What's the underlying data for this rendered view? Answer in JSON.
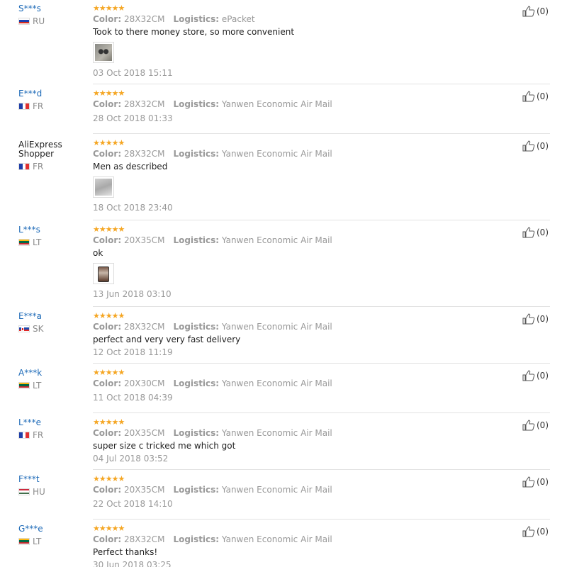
{
  "labels": {
    "color": "Color:",
    "logistics": "Logistics:"
  },
  "stars": "★★★★★",
  "reviews": [
    {
      "user": "S***s",
      "country": "RU",
      "flag": "ru",
      "color": "28X32CM",
      "logistics": "ePacket",
      "comment": "Took to there money store, so more convenient",
      "thumb": "earrings-photo",
      "date": "03 Oct 2018 15:11",
      "likes": "(0)"
    },
    {
      "user": "E***d",
      "country": "FR",
      "flag": "fr",
      "color": "28X32CM",
      "logistics": "Yanwen Economic Air Mail",
      "comment": "",
      "thumb": "",
      "date": "28 Oct 2018 01:33",
      "likes": "(0)"
    },
    {
      "user": "AliExpress Shopper",
      "country": "FR",
      "flag": "fr",
      "color": "28X32CM",
      "logistics": "Yanwen Economic Air Mail",
      "comment": "Men as described",
      "thumb": "package-photo",
      "date": "18 Oct 2018 23:40",
      "likes": "(0)"
    },
    {
      "user": "L***s",
      "country": "LT",
      "flag": "lt",
      "color": "20X35CM",
      "logistics": "Yanwen Economic Air Mail",
      "comment": "ok",
      "thumb": "phone-photo",
      "date": "13 Jun 2018 03:10",
      "likes": "(0)"
    },
    {
      "user": "E***a",
      "country": "SK",
      "flag": "sk",
      "color": "28X32CM",
      "logistics": "Yanwen Economic Air Mail",
      "comment": "perfect and very very fast delivery",
      "thumb": "",
      "date": "12 Oct 2018 11:19",
      "likes": "(0)"
    },
    {
      "user": "A***k",
      "country": "LT",
      "flag": "lt",
      "color": "20X30CM",
      "logistics": "Yanwen Economic Air Mail",
      "comment": "",
      "thumb": "",
      "date": "11 Oct 2018 04:39",
      "likes": "(0)"
    },
    {
      "user": "L***e",
      "country": "FR",
      "flag": "fr",
      "color": "20X35CM",
      "logistics": "Yanwen Economic Air Mail",
      "comment": "super size c tricked me which got",
      "thumb": "",
      "date": "04 Jul 2018 03:52",
      "likes": "(0)"
    },
    {
      "user": "F***t",
      "country": "HU",
      "flag": "hu",
      "color": "20X35CM",
      "logistics": "Yanwen Economic Air Mail",
      "comment": "",
      "thumb": "",
      "date": "22 Oct 2018 14:10",
      "likes": "(0)"
    },
    {
      "user": "G***e",
      "country": "LT",
      "flag": "lt",
      "color": "28X32CM",
      "logistics": "Yanwen Economic Air Mail",
      "comment": "Perfect thanks!",
      "thumb": "",
      "date": "30 Jun 2018 03:25",
      "likes": "(0)"
    }
  ]
}
